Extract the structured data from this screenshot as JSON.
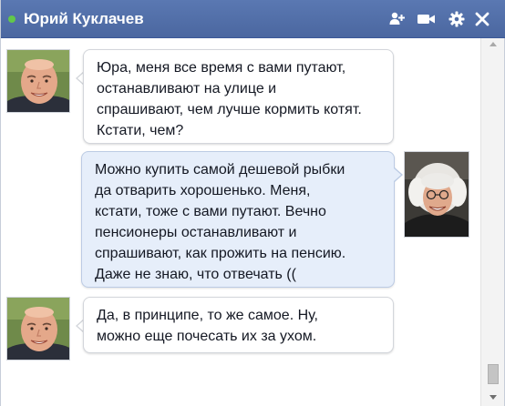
{
  "window": {
    "title": "Юрий Куклачев",
    "status": "online",
    "colors": {
      "titlebar": "#4b67a0",
      "online_dot": "#62c84a",
      "incoming_bubble": "#ffffff",
      "outgoing_bubble": "#e6eefa"
    },
    "toolbar_icons": [
      "add-friend-icon",
      "video-call-icon",
      "settings-gear-icon",
      "close-icon"
    ]
  },
  "messages": [
    {
      "direction": "incoming",
      "lines": [
        "Юра, меня все время с вами путают,",
        "останавливают на улице и",
        "спрашивают, чем лучше кормить котят.",
        "Кстати, чем?"
      ]
    },
    {
      "direction": "outgoing",
      "lines": [
        "Можно купить самой дешевой рыбки",
        "да отварить хорошенько. Меня,",
        "кстати, тоже с вами путают. Вечно",
        "пенсионеры останавливают и",
        "спрашивают, как прожить на пенсию.",
        "Даже не знаю, что отвечать (("
      ]
    },
    {
      "direction": "incoming",
      "lines": [
        "Да, в принципе, то же самое. Ну,",
        "можно еще почесать их за ухом."
      ]
    }
  ]
}
